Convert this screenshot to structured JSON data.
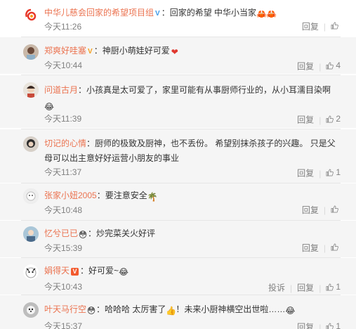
{
  "comments": [
    {
      "user": "中华儿慈会回家的希望项目组",
      "text": "回家的希望  中华小当家",
      "time": "今天11:26",
      "actions": [
        "回复"
      ],
      "likes": ""
    },
    {
      "user": "郑爽好哇塞",
      "text": "神厨小萌娃好可爱",
      "time": "今天10:44",
      "actions": [
        "回复"
      ],
      "likes": "4"
    },
    {
      "user": "问道古月",
      "text": "小孩真是太可爱了，家里可能有从事厨师行业的，从小耳濡目染啊",
      "time": "今天11:39",
      "actions": [
        "回复"
      ],
      "likes": "2"
    },
    {
      "user": "切记的心情",
      "text": "厨师的极致及厨神，也不丢份。 希望别抹杀孩子的兴趣。 只是父",
      "text2": "母可以出主意好好运营小朋友的事业",
      "time": "今天11:37",
      "actions": [
        "回复"
      ],
      "likes": "1"
    },
    {
      "user": "张家小妞2005",
      "text": "要注意安全",
      "time": "今天10:48",
      "actions": [
        "回复"
      ],
      "likes": ""
    },
    {
      "user": "忆兮已已",
      "text": "炒完菜关火好评",
      "time": "今天15:39",
      "actions": [
        "回复"
      ],
      "likes": ""
    },
    {
      "user": "娟得天",
      "text": "好可爱~",
      "time": "今天10:43",
      "actions": [
        "投诉",
        "回复"
      ],
      "likes": "1"
    },
    {
      "user": "叶天马行空",
      "text": "哈哈哈 太厉害了",
      "text_b": "！未来小厨神横空出世啦……",
      "time": "今天15:37",
      "actions": [
        "回复"
      ],
      "likes": "1"
    }
  ],
  "colors": {
    "username": "#eb7350",
    "text": "#333333",
    "meta": "#808080",
    "reply_bg": "#f5f5f5"
  },
  "icons": {
    "like": "thumbs-up-icon",
    "verified_blue": "verified-blue-icon",
    "verified_orange": "verified-orange-icon",
    "vip": "vip-badge-icon"
  }
}
